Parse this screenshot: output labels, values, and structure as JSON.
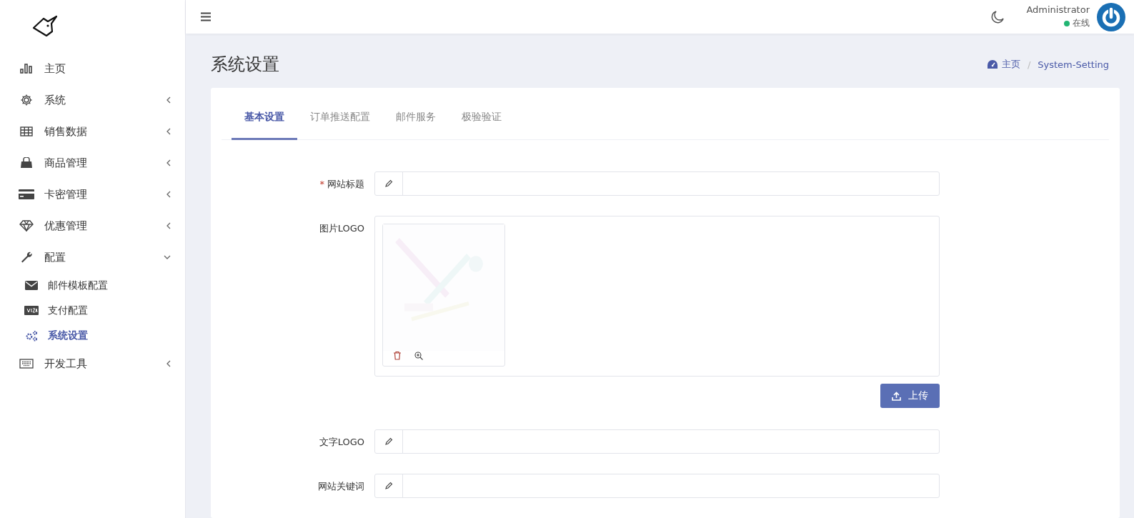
{
  "sidebar": {
    "items": [
      {
        "label": "主页",
        "kind": "link",
        "selected": false
      },
      {
        "label": "系统",
        "kind": "group",
        "expanded": false
      },
      {
        "label": "销售数据",
        "kind": "group",
        "expanded": false
      },
      {
        "label": "商品管理",
        "kind": "group",
        "expanded": false
      },
      {
        "label": "卡密管理",
        "kind": "group",
        "expanded": false
      },
      {
        "label": "优惠管理",
        "kind": "group",
        "expanded": false
      },
      {
        "label": "配置",
        "kind": "group",
        "expanded": true,
        "children": [
          {
            "label": "邮件模板配置",
            "selected": false
          },
          {
            "label": "支付配置",
            "selected": false
          },
          {
            "label": "系统设置",
            "selected": true
          }
        ]
      },
      {
        "label": "开发工具",
        "kind": "group",
        "expanded": false
      }
    ]
  },
  "header": {
    "user": "Administrator",
    "status": "在线"
  },
  "page": {
    "title": "系统设置",
    "breadcrumb": [
      "主页",
      "System-Setting"
    ],
    "breadcrumb_separator": "/"
  },
  "tabs": [
    {
      "label": "基本设置",
      "selected": true
    },
    {
      "label": "订单推送配置",
      "selected": false
    },
    {
      "label": "邮件服务",
      "selected": false
    },
    {
      "label": "极验验证",
      "selected": false
    }
  ],
  "form": {
    "required_mark": "*",
    "fields": [
      {
        "kind": "text",
        "label": "网站标题",
        "required": true
      },
      {
        "label": "图片LOGO",
        "required": false,
        "button": "上传"
      },
      {
        "kind": "text",
        "label": "文字LOGO",
        "required": false
      },
      {
        "kind": "text",
        "label": "网站关键词",
        "required": false
      }
    ]
  }
}
